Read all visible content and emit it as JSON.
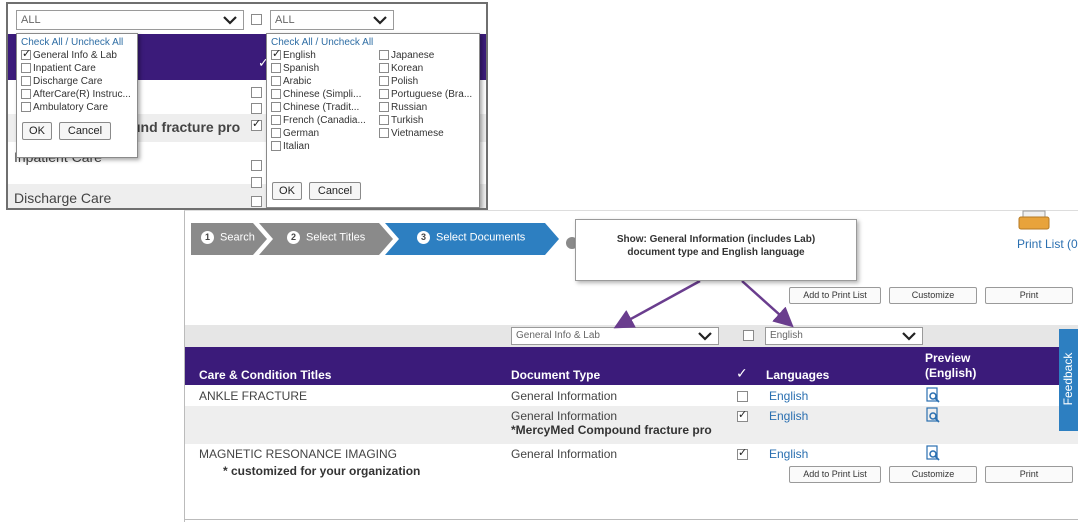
{
  "inset": {
    "doc_select": "ALL",
    "lang_select": "ALL",
    "bg_rows": {
      "truncated_title": "und fracture pro",
      "inpatient": "Inpatient Care",
      "discharge": "Discharge Care"
    },
    "doc_popup": {
      "check_all": "Check All / Uncheck All",
      "options": [
        {
          "label": "General Info & Lab",
          "checked": true
        },
        {
          "label": "Inpatient Care",
          "checked": false
        },
        {
          "label": "Discharge Care",
          "checked": false
        },
        {
          "label": "AfterCare(R) Instruc...",
          "checked": false
        },
        {
          "label": "Ambulatory Care",
          "checked": false
        }
      ],
      "ok": "OK",
      "cancel": "Cancel"
    },
    "lang_popup": {
      "check_all": "Check All / Uncheck All",
      "col1": [
        {
          "label": "English",
          "checked": true
        },
        {
          "label": "Spanish",
          "checked": false
        },
        {
          "label": "Arabic",
          "checked": false
        },
        {
          "label": "Chinese (Simpli...",
          "checked": false
        },
        {
          "label": "Chinese (Tradit...",
          "checked": false
        },
        {
          "label": "French (Canadia...",
          "checked": false
        },
        {
          "label": "German",
          "checked": false
        },
        {
          "label": "Italian",
          "checked": false
        }
      ],
      "col2": [
        {
          "label": "Japanese",
          "checked": false
        },
        {
          "label": "Korean",
          "checked": false
        },
        {
          "label": "Polish",
          "checked": false
        },
        {
          "label": "Portuguese (Bra...",
          "checked": false
        },
        {
          "label": "Russian",
          "checked": false
        },
        {
          "label": "Turkish",
          "checked": false
        },
        {
          "label": "Vietnamese",
          "checked": false
        }
      ],
      "ok": "OK",
      "cancel": "Cancel"
    }
  },
  "steps": {
    "search": "Search",
    "select_titles": "Select Titles",
    "select_documents": "Select Documents"
  },
  "callout": {
    "line1": "Show: General Information (includes Lab)",
    "line2": "document type and English language"
  },
  "toolbar": {
    "add": "Add to Print List",
    "customize": "Customize",
    "print": "Print",
    "print_list": "Print List (0"
  },
  "filters": {
    "doc_type": "General Info & Lab",
    "language": "English"
  },
  "table": {
    "headers": {
      "title": "Care & Condition Titles",
      "doc_type": "Document Type",
      "check": "✓",
      "languages": "Languages",
      "preview_1": "Preview",
      "preview_2": "(English)"
    },
    "rows": [
      {
        "title": "ANKLE FRACTURE",
        "doc": "General Information",
        "lang": "English",
        "checked": false
      },
      {
        "title": "",
        "doc": "General Information",
        "doc2": "*MercyMed Compound fracture pro",
        "lang": "English",
        "checked": true
      },
      {
        "title": "MAGNETIC RESONANCE IMAGING",
        "title2": "* customized for your organization",
        "doc": "General Information",
        "lang": "English",
        "checked": true
      }
    ]
  },
  "feedback": "Feedback",
  "colors": {
    "header_bg": "#3b1b7a",
    "step_active": "#2d7fc1",
    "step_inactive": "#8a8a8a",
    "link": "#2a6fb0",
    "arrow": "#6a3d8e"
  }
}
